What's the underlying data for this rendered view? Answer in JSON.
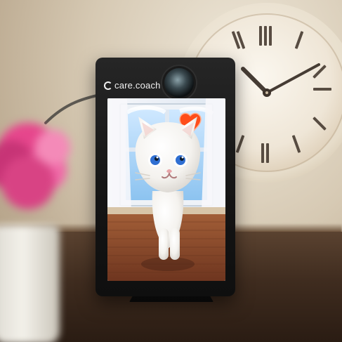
{
  "device": {
    "brand": "care.coach"
  },
  "colors": {
    "heart": "#ff4d1a",
    "cat_eyes": "#2f6fd2",
    "floor": "#8b4b2c",
    "device": "#171717"
  },
  "icons": {
    "heart": "heart-icon",
    "camera": "camera-icon"
  }
}
